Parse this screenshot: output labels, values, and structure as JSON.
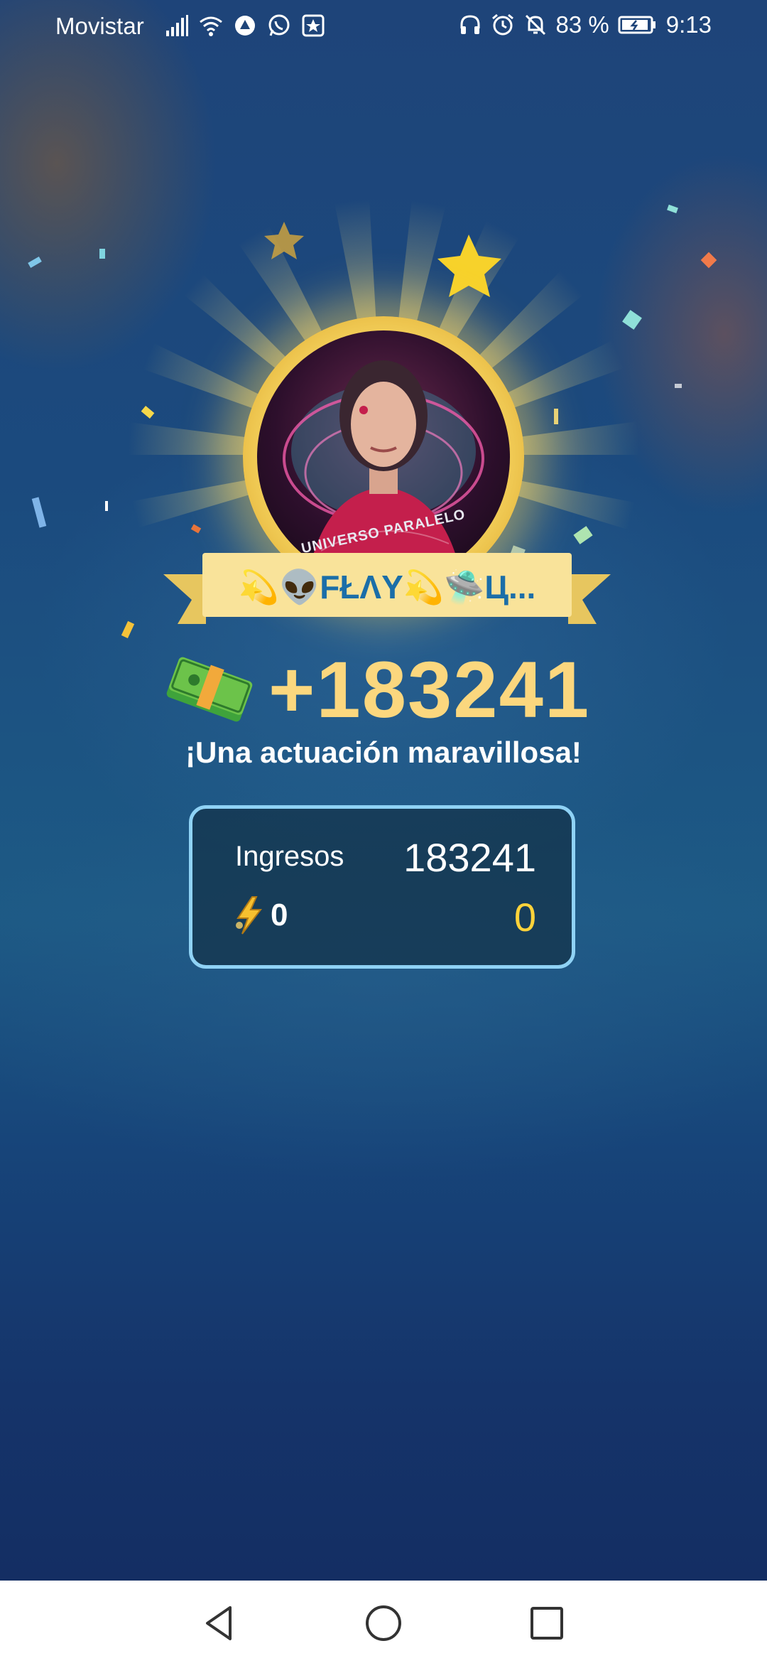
{
  "status_bar": {
    "carrier": "Movistar",
    "battery": "83 %",
    "time": "9:13",
    "icons": [
      "signal-icon",
      "wifi-icon",
      "app-notification-icon",
      "whatsapp-icon",
      "app-icon",
      "headphones-icon",
      "alarm-icon",
      "mute-icon",
      "battery-icon"
    ]
  },
  "result": {
    "performer_name": "💫👽FŁΛY💫🛸Ц...",
    "avatar_caption": "UNIVERSO PARALELO",
    "reward_amount": "+183241",
    "message": "¡Una actuación maravillosa!"
  },
  "panel": {
    "income_label": "Ingresos",
    "income_value": "183241",
    "bolt_count": "0",
    "bonus_value": "0"
  },
  "colors": {
    "reward_gold": "#fbd77e",
    "bonus_yellow": "#ffd33a",
    "panel_border": "#8fd2f5",
    "ribbon": "#f9e39a"
  },
  "navigation": {
    "icons": [
      "back-icon",
      "home-icon",
      "recents-icon"
    ]
  }
}
